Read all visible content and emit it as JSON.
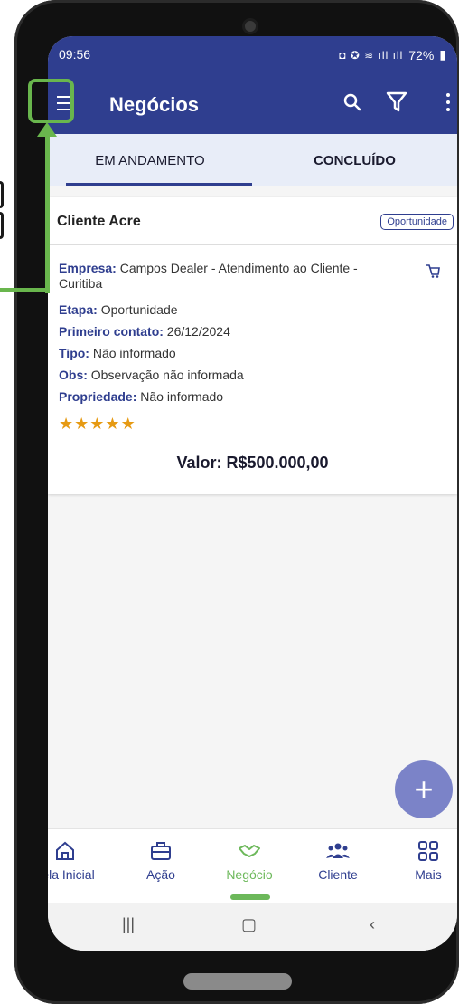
{
  "status": {
    "time": "09:56",
    "battery": "72%"
  },
  "appbar": {
    "title": "Negócios"
  },
  "tabs": [
    {
      "label": "EM ANDAMENTO"
    },
    {
      "label": "CONCLUÍDO"
    }
  ],
  "card": {
    "title": "Cliente Acre",
    "badge": "Oportunidade",
    "company_label": "Empresa:",
    "company_value": "Campos Dealer - Atendimento ao Cliente - Curitiba",
    "stage_label": "Etapa:",
    "stage_value": "Oportunidade",
    "first_contact_label": "Primeiro contato:",
    "first_contact_value": "26/12/2024",
    "type_label": "Tipo:",
    "type_value": "Não informado",
    "notes_label": "Obs:",
    "notes_value": "Observação não informada",
    "property_label": "Propriedade:",
    "property_value": "Não informado",
    "rating": 5,
    "total": "Valor: R$500.000,00"
  },
  "bottom_nav": [
    {
      "label": "Tela Inicial",
      "icon": "home-icon"
    },
    {
      "label": "Ação",
      "icon": "briefcase-icon"
    },
    {
      "label": "Negócio",
      "icon": "handshake-icon"
    },
    {
      "label": "Cliente",
      "icon": "users-icon"
    },
    {
      "label": "Mais",
      "icon": "grid-icon"
    }
  ],
  "colors": {
    "primary": "#2f3e8f",
    "active_nav": "#6cb85a",
    "annotation": "#69b64d",
    "stars": "#e69a13"
  }
}
